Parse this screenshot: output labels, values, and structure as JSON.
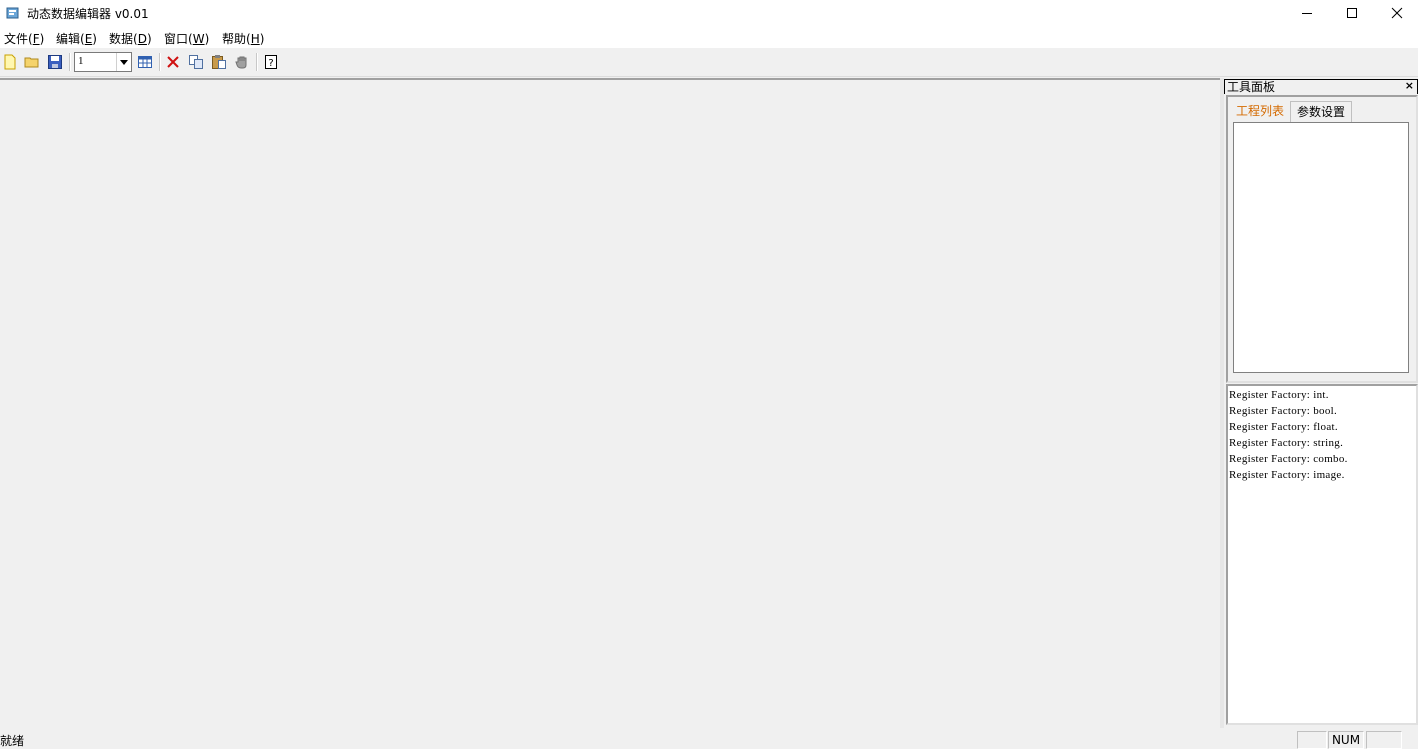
{
  "window": {
    "title": "动态数据编辑器 v0.01"
  },
  "menu": {
    "items": [
      {
        "label": "文件(",
        "key": "F",
        "end": ")"
      },
      {
        "label": "编辑(",
        "key": "E",
        "end": ")"
      },
      {
        "label": "数据(",
        "key": "D",
        "end": ")"
      },
      {
        "label": "窗口(",
        "key": "W",
        "end": ")"
      },
      {
        "label": "帮助(",
        "key": "H",
        "end": ")"
      }
    ]
  },
  "toolbar": {
    "combo_value": "1"
  },
  "panel": {
    "title": "工具面板",
    "close": "×",
    "tabs": [
      {
        "label": "工程列表"
      },
      {
        "label": "参数设置"
      }
    ]
  },
  "log": {
    "lines": [
      "Register Factory: int.",
      "Register Factory: bool.",
      "Register Factory: float.",
      "Register Factory: string.",
      "Register Factory: combo.",
      "Register Factory: image."
    ]
  },
  "status": {
    "text": "就绪",
    "num": "NUM"
  },
  "colors": {
    "active_tab": "#d46a00",
    "background": "#f0f0f0"
  }
}
